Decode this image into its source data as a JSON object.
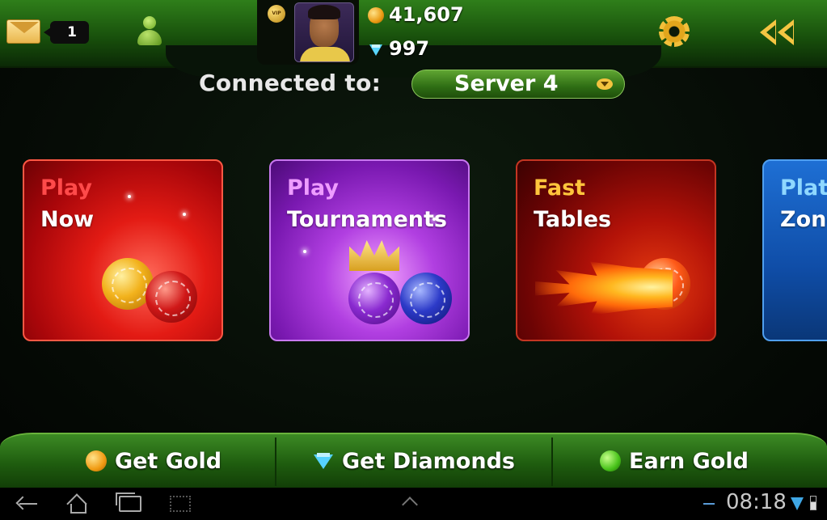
{
  "header": {
    "mail_count": "1",
    "vip_label": "VIP",
    "gold": "41,607",
    "diamonds": "997"
  },
  "server": {
    "label": "Connected to:",
    "selected": "Server 4"
  },
  "cards": [
    {
      "line1": "Play",
      "line2": "Now"
    },
    {
      "line1": "Play",
      "line2": "Tournaments"
    },
    {
      "line1": "Fast",
      "line2": "Tables"
    },
    {
      "line1": "Plati",
      "line2": "Zone"
    }
  ],
  "bottom": {
    "get_gold": "Get Gold",
    "get_diamonds": "Get Diamonds",
    "earn_gold": "Earn Gold"
  },
  "system": {
    "time": "08:18"
  },
  "colors": {
    "brand_green": "#1f5d0f",
    "accent_gold": "#f4c542",
    "play_now": "#e31b14",
    "tournaments": "#b13fe1",
    "fast_tables": "#b31208",
    "platinum": "#1e6fd4"
  },
  "icons": [
    "mail-icon",
    "friends-icon",
    "vip-badge",
    "avatar",
    "gold-coin-icon",
    "diamond-icon",
    "gear-icon",
    "back-double-chevron-icon",
    "chevron-down-icon",
    "back-nav-icon",
    "home-nav-icon",
    "recent-apps-icon",
    "screenshot-icon",
    "wifi-icon",
    "battery-icon"
  ]
}
